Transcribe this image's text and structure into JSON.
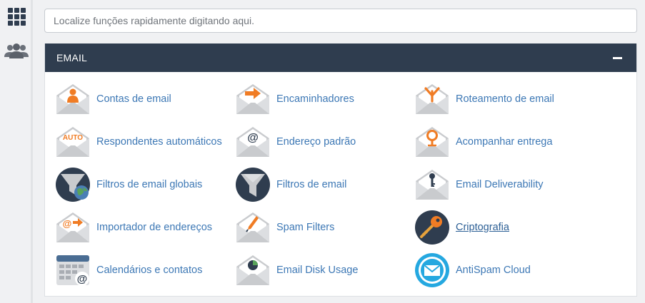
{
  "search": {
    "placeholder": "Localize funções rapidamente digitando aqui."
  },
  "section": {
    "title": "EMAIL",
    "items": [
      {
        "label": "Contas de email",
        "icon": "email-accounts-icon"
      },
      {
        "label": "Encaminhadores",
        "icon": "forwarders-icon"
      },
      {
        "label": "Roteamento de email",
        "icon": "email-routing-icon"
      },
      {
        "label": "Respondentes automáticos",
        "icon": "autoresponders-icon",
        "badge": "AUTO"
      },
      {
        "label": "Endereço padrão",
        "icon": "default-address-icon",
        "badge": "@"
      },
      {
        "label": "Acompanhar entrega",
        "icon": "track-delivery-icon"
      },
      {
        "label": "Filtros de email globais",
        "icon": "global-email-filters-icon"
      },
      {
        "label": "Filtros de email",
        "icon": "email-filters-icon"
      },
      {
        "label": "Email Deliverability",
        "icon": "email-deliverability-icon"
      },
      {
        "label": "Importador de endereços",
        "icon": "address-importer-icon",
        "badge": "@"
      },
      {
        "label": "Spam Filters",
        "icon": "spam-filters-icon"
      },
      {
        "label": "Criptografia",
        "icon": "encryption-icon"
      },
      {
        "label": "Calendários e contatos",
        "icon": "calendars-contacts-icon",
        "badge": "@"
      },
      {
        "label": "Email Disk Usage",
        "icon": "email-disk-usage-icon"
      },
      {
        "label": "AntiSpam Cloud",
        "icon": "antispam-cloud-icon"
      }
    ]
  },
  "colors": {
    "header": "#2f3d4f",
    "link": "#3d78b5",
    "accent": "#f07c24",
    "envelope": "#c9cbce"
  }
}
